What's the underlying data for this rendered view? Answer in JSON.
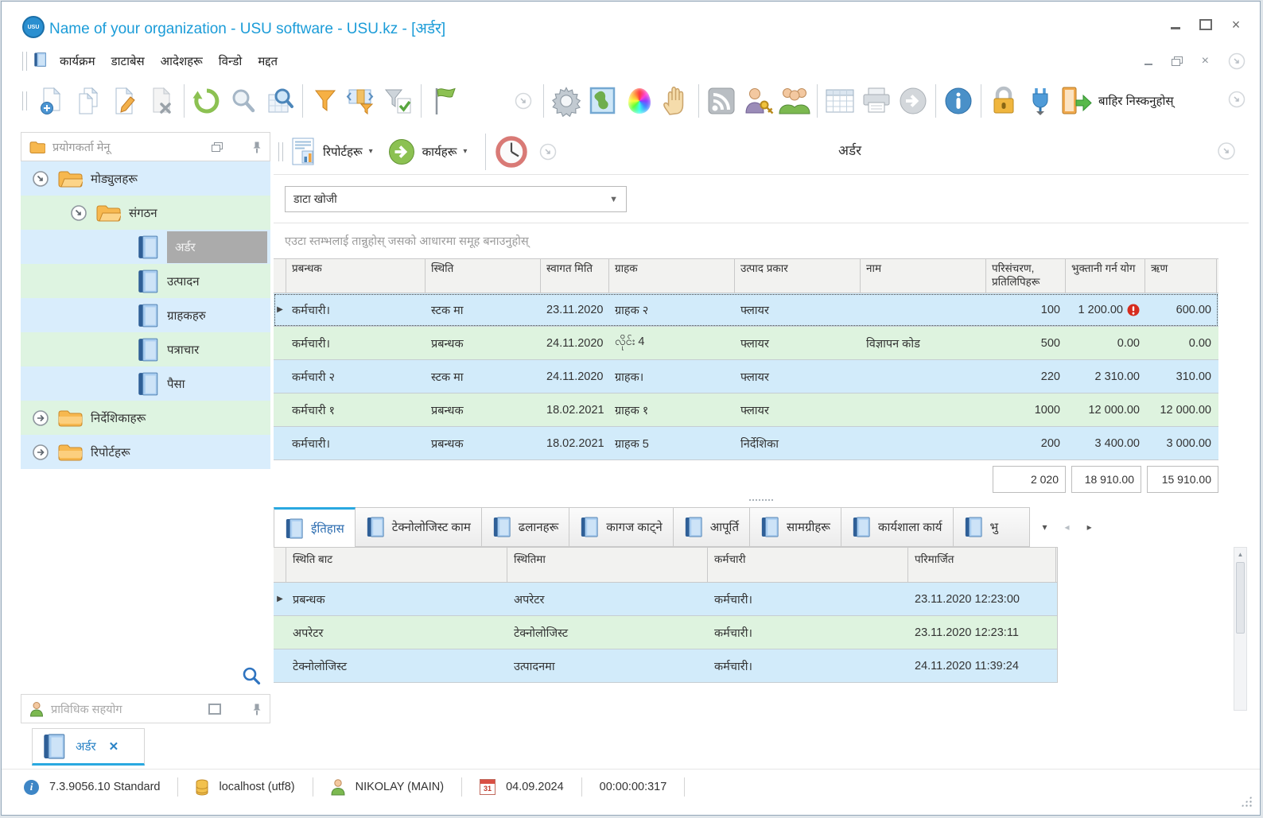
{
  "colors": {
    "accent_blue": "#29a8e0",
    "title_blue": "#1b9cd8",
    "row_blue": "#d2ebfa",
    "row_green": "#def3df",
    "selected_gray": "#ababab",
    "alert_red": "#d62c1e"
  },
  "window": {
    "title": "Name of your organization - USU software - USU.kz - [अर्डर]",
    "menu": [
      "कार्यक्रम",
      "डाटाबेस",
      "आदेशहरू",
      "विन्डो",
      "मद्दत"
    ],
    "exit_label": "बाहिर निस्कनुहोस्"
  },
  "icons": {
    "toolbar": [
      "new-document",
      "copy-document",
      "edit-document",
      "delete-document",
      "refresh",
      "search",
      "search-grid",
      "filter",
      "filter-column",
      "filter-check",
      "flag",
      "chevron-circle",
      "settings-gear",
      "map",
      "color-wheel",
      "hand",
      "rss",
      "user-key",
      "users-group",
      "table-grid",
      "printer",
      "arrow-circle",
      "info",
      "lock",
      "plug",
      "exit-door"
    ],
    "panel": [
      "reports-doc",
      "actions-arrow",
      "clock"
    ],
    "tree": [
      "folder-open",
      "folder-closed",
      "book",
      "expand-down",
      "expand-right",
      "search"
    ],
    "status": [
      "info",
      "database",
      "user",
      "calendar",
      "resize-grip"
    ]
  },
  "sidebar": {
    "header": "प्रयोगकर्ता मेनू",
    "tree": [
      {
        "label": "मोड्युलहरू"
      },
      {
        "label": "संगठन"
      },
      {
        "label": "अर्डर"
      },
      {
        "label": "उत्पादन"
      },
      {
        "label": "ग्राहकहरु"
      },
      {
        "label": "पत्राचार"
      },
      {
        "label": "पैसा"
      },
      {
        "label": "निर्देशिकाहरू"
      },
      {
        "label": "रिपोर्टहरू"
      }
    ],
    "support_header": "प्राविधिक सहयोग"
  },
  "panel": {
    "reports_button": "रिपोर्टहरू",
    "actions_button": "कार्यहरू",
    "title": "अर्डर",
    "search_placeholder": "डाटा खोजी",
    "groupby_hint": "एउटा स्तम्भलाई तान्नुहोस् जसको आधारमा समूह बनाउनुहोस्"
  },
  "orders_table": {
    "columns": [
      "प्रबन्धक",
      "स्थिति",
      "स्वागत मिति",
      "ग्राहक",
      "उत्पाद प्रकार",
      "नाम",
      "परिसंचरण, प्रतिलिपिहरू",
      "भुक्तानी गर्न योग",
      "ऋण"
    ],
    "rows": [
      {
        "manager": "कर्मचारी।",
        "status": "स्टक मा",
        "date": "23.11.2020",
        "client": "ग्राहक २",
        "product": "फ्लायर",
        "name": "",
        "qty": "100",
        "pay": "1 200.00",
        "debt": "600.00"
      },
      {
        "manager": "कर्मचारी।",
        "status": "प्रबन्धक",
        "date": "24.11.2020",
        "client": "လိုင်း 4",
        "product": "फ्लायर",
        "name": "विज्ञापन कोड",
        "qty": "500",
        "pay": "0.00",
        "debt": "0.00"
      },
      {
        "manager": "कर्मचारी २",
        "status": "स्टक मा",
        "date": "24.11.2020",
        "client": "ग्राहक।",
        "product": "फ्लायर",
        "name": "",
        "qty": "220",
        "pay": "2 310.00",
        "debt": "310.00"
      },
      {
        "manager": "कर्मचारी १",
        "status": "प्रबन्धक",
        "date": "18.02.2021",
        "client": "ग्राहक १",
        "product": "फ्लायर",
        "name": "",
        "qty": "1000",
        "pay": "12 000.00",
        "debt": "12 000.00"
      },
      {
        "manager": "कर्मचारी।",
        "status": "प्रबन्धक",
        "date": "18.02.2021",
        "client": "ग्राहक 5",
        "product": "निर्देशिका",
        "name": "",
        "qty": "200",
        "pay": "3 400.00",
        "debt": "3 000.00"
      }
    ],
    "totals": {
      "qty": "2 020",
      "pay": "18 910.00",
      "debt": "15 910.00"
    }
  },
  "detail_tabs": [
    "ईतिहास",
    "टेक्नोलोजिस्ट काम",
    "ढलानहरू",
    "कागज काट्ने",
    "आपूर्ति",
    "सामग्रीहरू",
    "कार्यशाला कार्य",
    "भु"
  ],
  "history_table": {
    "columns": [
      "स्थिति बाट",
      "स्थितिमा",
      "कर्मचारी",
      "परिमार्जित"
    ],
    "rows": [
      {
        "from": "प्रबन्धक",
        "to": "अपरेटर",
        "employee": "कर्मचारी।",
        "modified": "23.11.2020 12:23:00"
      },
      {
        "from": "अपरेटर",
        "to": "टेक्नोलोजिस्ट",
        "employee": "कर्मचारी।",
        "modified": "23.11.2020 12:23:11"
      },
      {
        "from": "टेक्नोलोजिस्ट",
        "to": "उत्पादनमा",
        "employee": "कर्मचारी।",
        "modified": "24.11.2020 11:39:24"
      }
    ]
  },
  "bottom_tab": "अर्डर",
  "statusbar": {
    "version": "7.3.9056.10 Standard",
    "db": "localhost (utf8)",
    "user": "NIKOLAY (MAIN)",
    "date": "04.09.2024",
    "calendar_day": "31",
    "timer": "00:00:00:317"
  }
}
